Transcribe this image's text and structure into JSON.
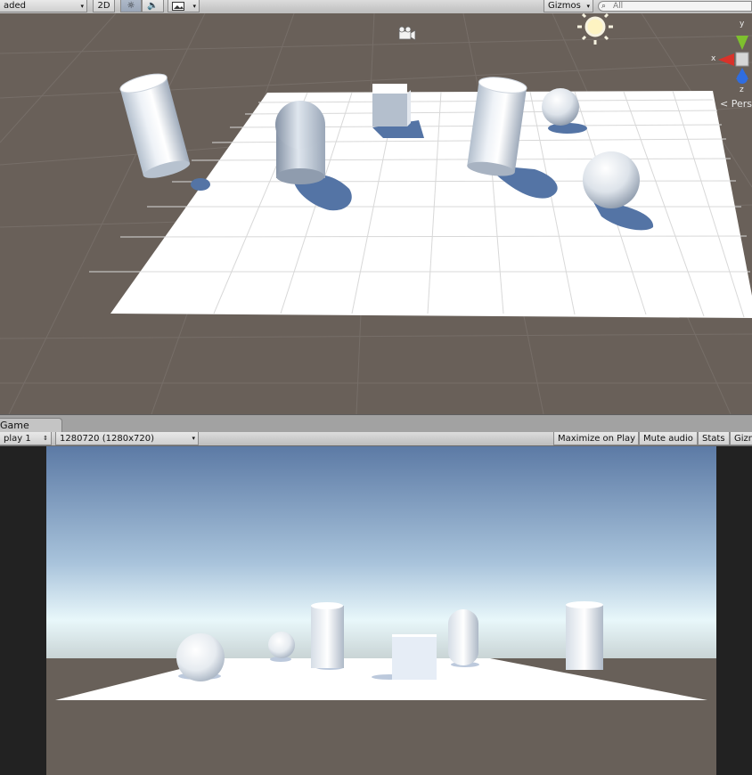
{
  "scene_toolbar": {
    "shading_mode": "aded",
    "mode_2d": "2D",
    "gizmos_label": "Gizmos",
    "search_placeholder": "All"
  },
  "scene_view": {
    "gizmo_axis_y": "y",
    "gizmo_axis_x": "x",
    "gizmo_axis_z": "z",
    "projection_label": "Pers"
  },
  "game_panel": {
    "tab_label": "Game",
    "display_label": "play 1",
    "resolution_label": "1280720 (1280x720)",
    "maximize_on_play": "Maximize on Play",
    "mute_audio": "Mute audio",
    "stats": "Stats",
    "gizmos": "Gizm"
  },
  "icons": [
    "light-toggle-icon",
    "audio-toggle-icon",
    "image-effects-icon",
    "search-icon",
    "camera-icon",
    "sun-light-icon",
    "axis-gizmo-icon"
  ],
  "colors": {
    "scene_background": "#696059",
    "ground_plane": "#ffffff",
    "toolbar": "#cfcfcf",
    "sky_top": "#5c7aa5",
    "sky_horizon": "#e8f7fa",
    "axis_x": "#d8322a",
    "axis_y": "#7ec02e",
    "axis_z": "#2f6de0"
  }
}
